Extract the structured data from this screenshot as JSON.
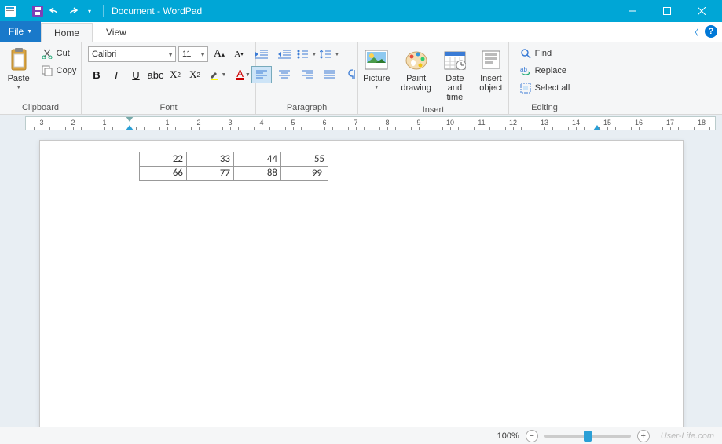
{
  "window": {
    "title": "Document - WordPad"
  },
  "tabs": {
    "file": "File",
    "home": "Home",
    "view": "View"
  },
  "clipboard": {
    "paste": "Paste",
    "cut": "Cut",
    "copy": "Copy",
    "group": "Clipboard"
  },
  "font": {
    "name": "Calibri",
    "size": "11",
    "group": "Font"
  },
  "paragraph": {
    "group": "Paragraph"
  },
  "insert": {
    "picture": "Picture",
    "paint": "Paint\ndrawing",
    "datetime": "Date and\ntime",
    "object": "Insert\nobject",
    "group": "Insert"
  },
  "editing": {
    "find": "Find",
    "replace": "Replace",
    "selectall": "Select all",
    "group": "Editing"
  },
  "ruler": {
    "numbers": [
      "3",
      "2",
      "1",
      "",
      "1",
      "2",
      "3",
      "4",
      "5",
      "6",
      "7",
      "8",
      "9",
      "10",
      "11",
      "12",
      "13",
      "14",
      "15",
      "16",
      "17",
      "18"
    ]
  },
  "table": {
    "rows": [
      [
        "22",
        "33",
        "44",
        "55"
      ],
      [
        "66",
        "77",
        "88",
        "99"
      ]
    ]
  },
  "status": {
    "zoom": "100%",
    "watermark": "User-Life.com"
  }
}
